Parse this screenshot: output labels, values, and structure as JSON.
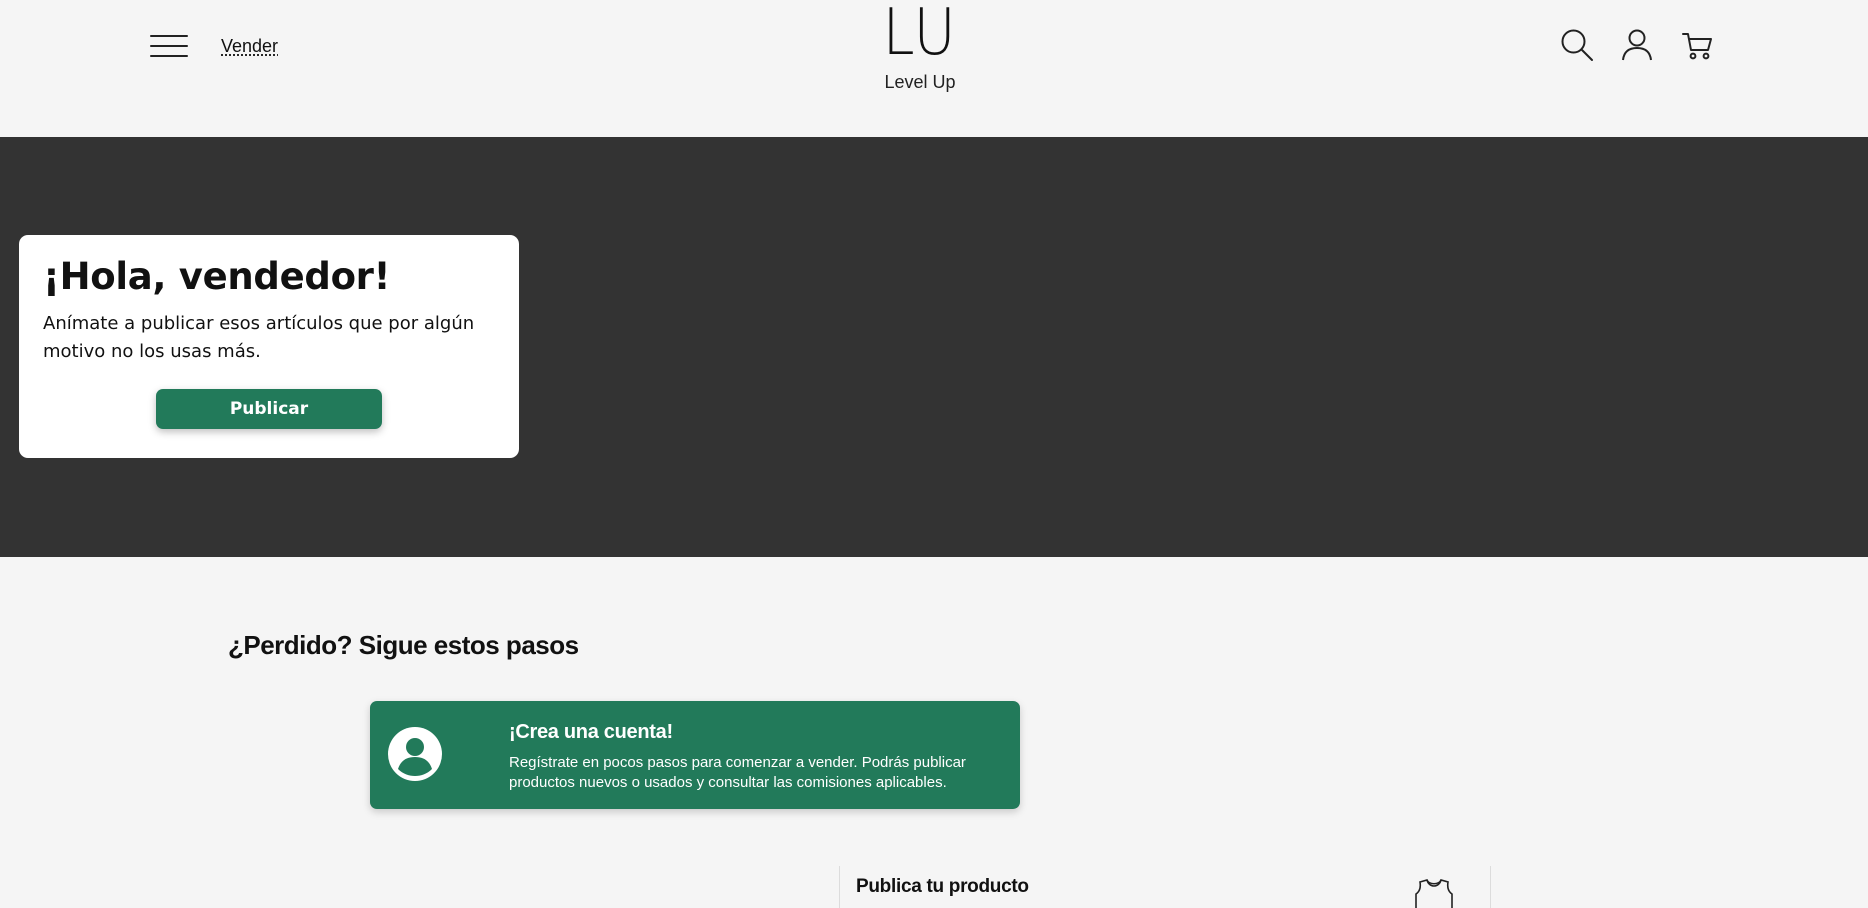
{
  "header": {
    "menu_icon": "hamburger-menu-icon",
    "sell_link": "Vender",
    "logo_mark": "LU",
    "logo_name": "Level Up",
    "icons": [
      "search-icon",
      "user-icon",
      "cart-icon"
    ]
  },
  "hero": {
    "title": "¡Hola, vendedor!",
    "text": "Anímate a publicar esos artículos que por algún motivo no los usas más.",
    "button_label": "Publicar"
  },
  "steps": {
    "title": "¿Perdido? Sigue estos pasos",
    "items": [
      {
        "icon": "user-circle-icon",
        "title": "¡Crea una cuenta!",
        "text": "Regístrate en pocos pasos para comenzar a vender. Podrás publicar productos nuevos o usados y consultar las comisiones aplicables."
      }
    ],
    "publish_panel": {
      "title": "Publica tu producto",
      "icon": "jersey-icon"
    }
  },
  "colors": {
    "accent": "#227a5a",
    "hero_bg": "#333333",
    "page_bg": "#f5f5f5",
    "card_bg": "#ffffff"
  }
}
